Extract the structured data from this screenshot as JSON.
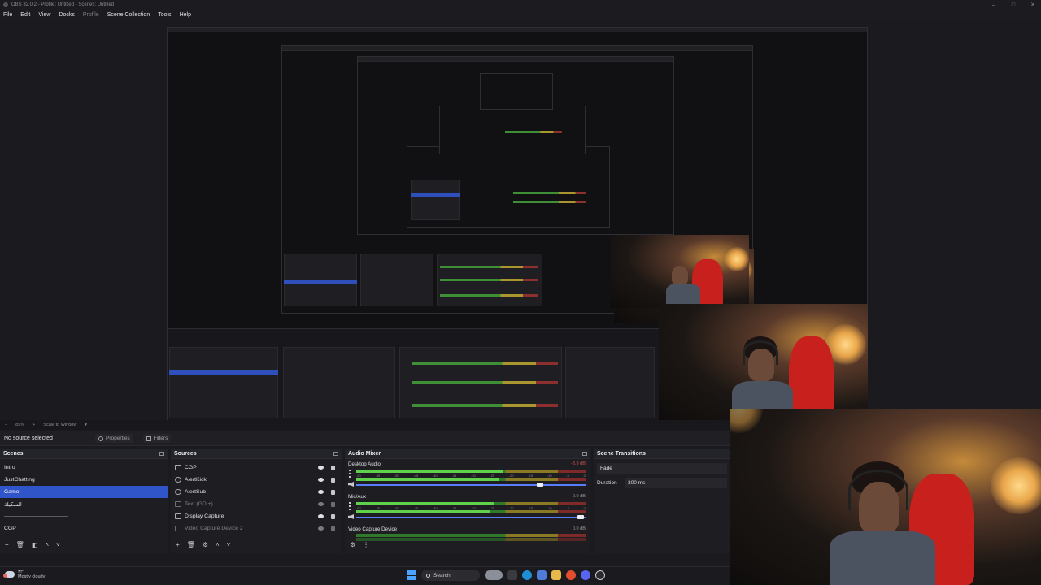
{
  "window": {
    "title": "OBS 32.0.2 - Profile: Untitled - Scenes: Untitled",
    "controls": [
      "–",
      "□",
      "✕"
    ]
  },
  "menu": [
    "File",
    "Edit",
    "View",
    "Docks",
    "Profile",
    "Scene Collection",
    "Tools",
    "Help"
  ],
  "zoom": {
    "level": "89%",
    "scale_mode": "Scale to Window"
  },
  "context": {
    "no_source": "No source selected",
    "properties": "Properties",
    "filters": "Filters"
  },
  "scenes": {
    "title": "Scenes",
    "items": [
      "Intro",
      "JustChatting",
      "Game",
      "السكيلة",
      "",
      "CGP"
    ],
    "selected_index": 2
  },
  "sources": {
    "title": "Sources",
    "items": [
      {
        "name": "CGP",
        "icon": "list-icon",
        "visible": true,
        "locked": true
      },
      {
        "name": "AlertKick",
        "icon": "browser-icon",
        "visible": true,
        "locked": true
      },
      {
        "name": "AlertSub",
        "icon": "browser-icon",
        "visible": true,
        "locked": true
      },
      {
        "name": "Text (GDI+)",
        "icon": "text-icon",
        "visible": false,
        "locked": false
      },
      {
        "name": "Display Capture",
        "icon": "monitor-icon",
        "visible": true,
        "locked": true
      },
      {
        "name": "Video Capture Device 2",
        "icon": "camera-icon",
        "visible": false,
        "locked": false
      }
    ]
  },
  "mixer": {
    "title": "Audio Mixer",
    "ticks": [
      "-60",
      "-55",
      "-50",
      "-45",
      "-40",
      "-35",
      "-30",
      "-25",
      "-20",
      "-15",
      "-10",
      "-5",
      "0"
    ],
    "channels": [
      {
        "name": "Desktop Audio",
        "db": "-3.9 dB",
        "level": 0.64,
        "volume": 0.81
      },
      {
        "name": "Mic/Aux",
        "db": "0.0 dB",
        "level": 0.66,
        "volume": 0.98
      },
      {
        "name": "Video Capture Device",
        "db": "0.0 dB",
        "level": 0.0,
        "volume": 1.0
      }
    ]
  },
  "transitions": {
    "title": "Scene Transitions",
    "type": "Fade",
    "duration_label": "Duration",
    "duration": "300 ms"
  },
  "taskbar": {
    "weather_temp": "٣٢°",
    "weather_desc": "Mostly cloudy",
    "search_placeholder": "Search"
  }
}
